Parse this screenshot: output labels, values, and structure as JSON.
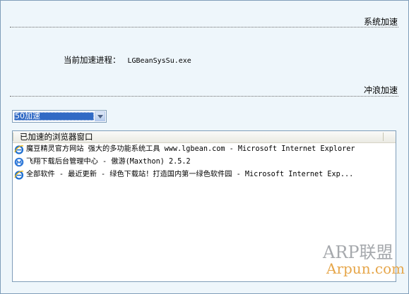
{
  "sections": {
    "system_accel": "系统加速",
    "surf_accel": "冲浪加速"
  },
  "process": {
    "label": "当前加速进程：",
    "value": "LGBeanSysSu.exe"
  },
  "dropdown": {
    "selected": "50加速"
  },
  "list": {
    "header": "已加速的浏览器窗口",
    "items": [
      {
        "icon": "ie-icon",
        "text": "魔豆精灵官方网站 强大的多功能系统工具 www.lgbean.com - Microsoft Internet Explorer"
      },
      {
        "icon": "maxthon-icon",
        "text": "飞翔下载后台管理中心 - 傲游(Maxthon) 2.5.2"
      },
      {
        "icon": "ie-icon",
        "text": "全部软件 - 最近更新 - 绿色下载站！打造国内第一绿色软件园 - Microsoft Internet Exp..."
      }
    ]
  },
  "watermark": {
    "line1": "ARP联盟",
    "line2": "Arpun.com"
  }
}
